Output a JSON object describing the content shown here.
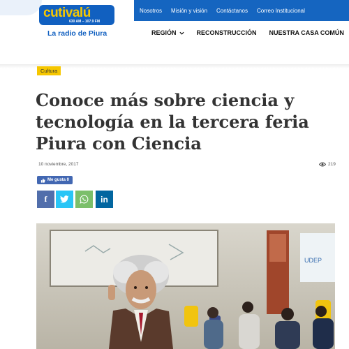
{
  "topbar": {
    "links": [
      "Nosotros",
      "Misión y visión",
      "Contáctanos",
      "Correo Institucional"
    ]
  },
  "logo": {
    "name": "cutivalú",
    "frequency": "630 AM – 107.9 FM",
    "tagline": "La radio de Piura"
  },
  "nav": {
    "items": [
      "REGIÓN",
      "RECONSTRUCCIÓN",
      "NUESTRA CASA COMÚN"
    ]
  },
  "article": {
    "category": "Cultura",
    "title": "Conoce más sobre ciencia y tecnología en la tercera feria Piura con Ciencia",
    "date": "10 noviembre, 2017",
    "views": "219",
    "like_label": "Me gusta 0"
  },
  "share": {
    "facebook": "f",
    "linkedin": "in"
  },
  "colors": {
    "brand_blue": "#1565c0",
    "accent_yellow": "#f6c700",
    "facebook": "#516eab",
    "twitter": "#29c5f6",
    "whatsapp": "#7bbf6a",
    "linkedin": "#0266a0"
  },
  "icons": [
    "home-icon",
    "chevron-down-icon",
    "eye-icon",
    "thumbs-up-icon",
    "twitter-icon",
    "whatsapp-icon"
  ]
}
